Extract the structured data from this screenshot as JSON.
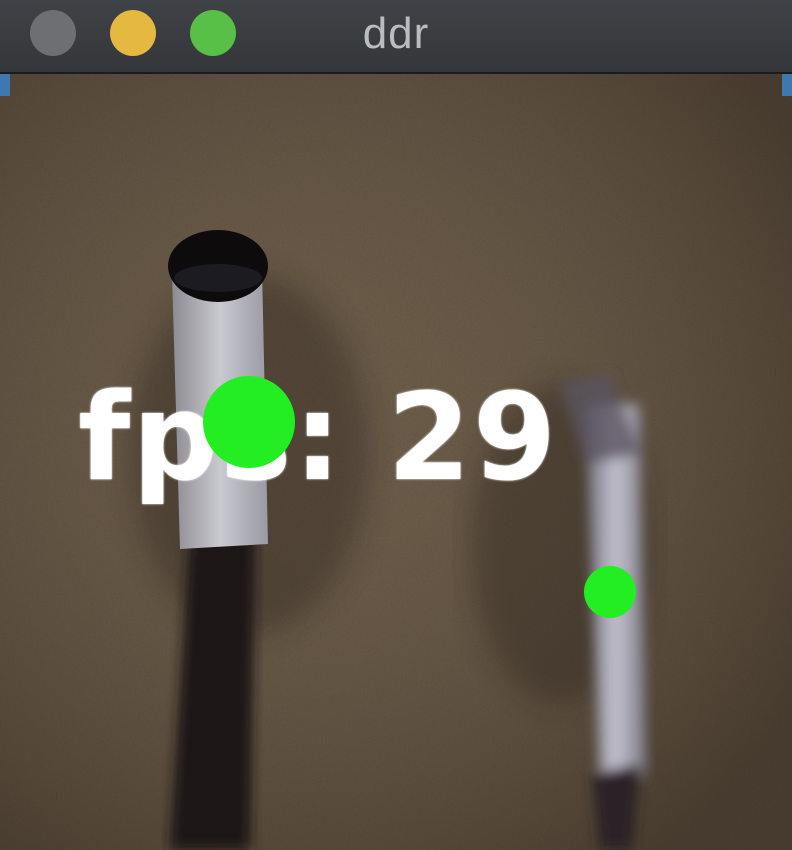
{
  "window": {
    "title": "ddr",
    "buttons": [
      {
        "name": "close",
        "color": "#6e6f72"
      },
      {
        "name": "minimize",
        "color": "#e5b840"
      },
      {
        "name": "zoom",
        "color": "#58c047"
      }
    ]
  },
  "video": {
    "overlay_text": "fps: 29",
    "marker_color": "#22ee22"
  }
}
